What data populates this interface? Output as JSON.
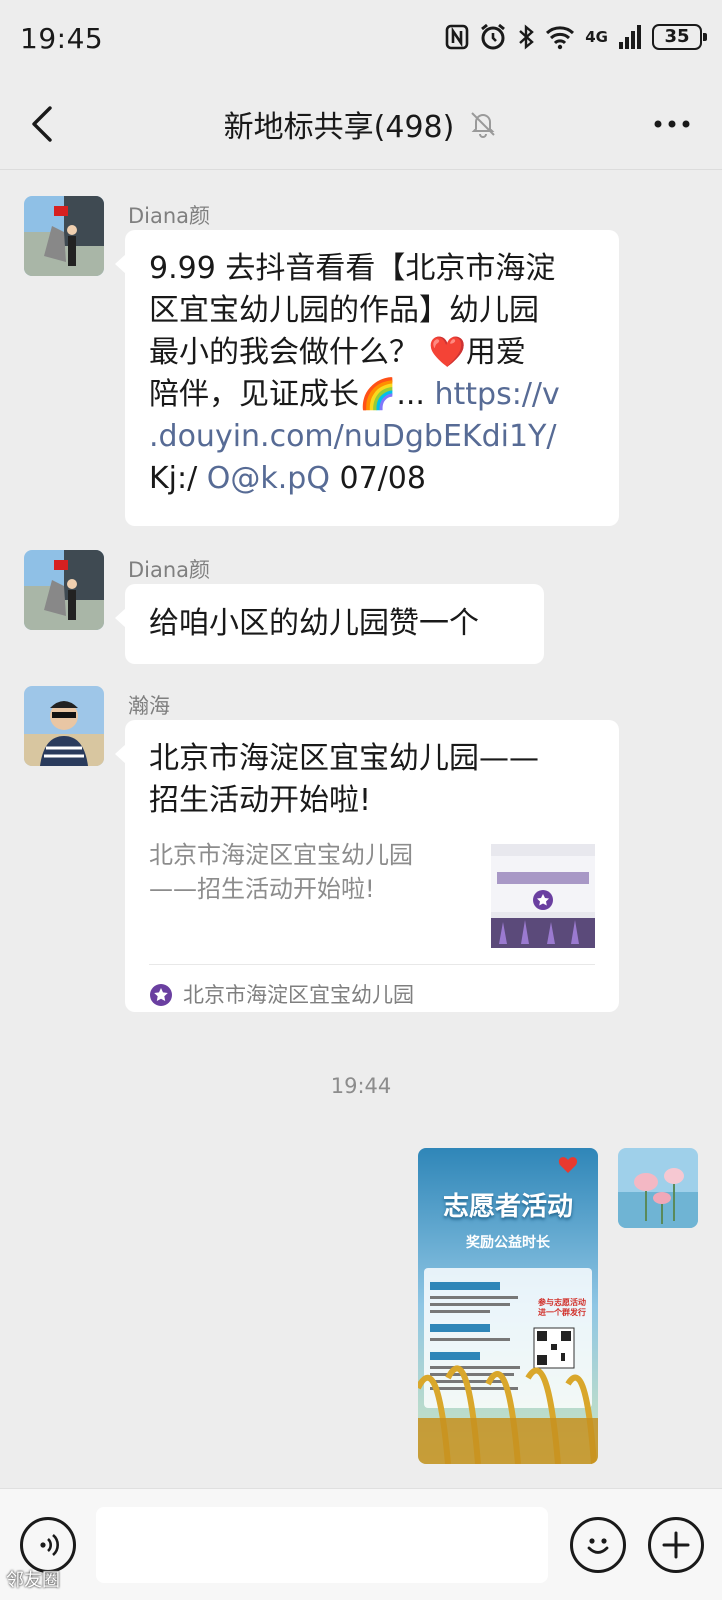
{
  "status_bar": {
    "time": "19:45",
    "network_label": "4G",
    "battery": "35",
    "icons": [
      "nfc-icon",
      "alarm-icon",
      "bluetooth-icon",
      "wifi-icon",
      "signal-icon",
      "battery-icon"
    ]
  },
  "header": {
    "title": "新地标共享(498)",
    "back_icon": "chevron-left-icon",
    "mute_icon": "bell-muted-icon",
    "more_icon": "more-dots-icon"
  },
  "messages": [
    {
      "sender": "Diana颜",
      "lines": [
        "9.99 去抖音看看【北京市海淀",
        "区宜宝幼儿园的作品】幼儿园",
        "最小的我会做什么？ ❤️用爱",
        "陪伴，见证成长🌈... "
      ],
      "link_part1": "https://v",
      "link_part2": ".douyin.com/nuDgbEKdi1Y/",
      "code_prefix": "Kj:/ ",
      "code_link": "O@k.pQ",
      "code_suffix": " 07/08"
    },
    {
      "sender": "Diana颜",
      "text": "给咱小区的幼儿园赞一个"
    },
    {
      "sender": "瀚海",
      "card_title_line1": "北京市海淀区宜宝幼儿园——",
      "card_title_line2": "招生活动开始啦!",
      "card_desc_line1": "北京市海淀区宜宝幼儿园",
      "card_desc_line2": "——招生活动开始啦!",
      "card_source": "北京市海淀区宜宝幼儿园"
    }
  ],
  "timestamp": "19:44",
  "image_message": {
    "poster_title": "志愿者活动",
    "poster_subtitle": "奖励公益时长",
    "poster_join": "参与志愿活动",
    "poster_join2": "进一个群发行"
  },
  "input_bar": {
    "voice_icon": "voice-icon",
    "emoji_icon": "emoji-icon",
    "plus_icon": "plus-icon"
  },
  "watermark": "邻友圈",
  "colors": {
    "background": "#ededed",
    "bubble": "#ffffff",
    "link": "#576b95",
    "secondary_text": "#7f7f7f"
  }
}
